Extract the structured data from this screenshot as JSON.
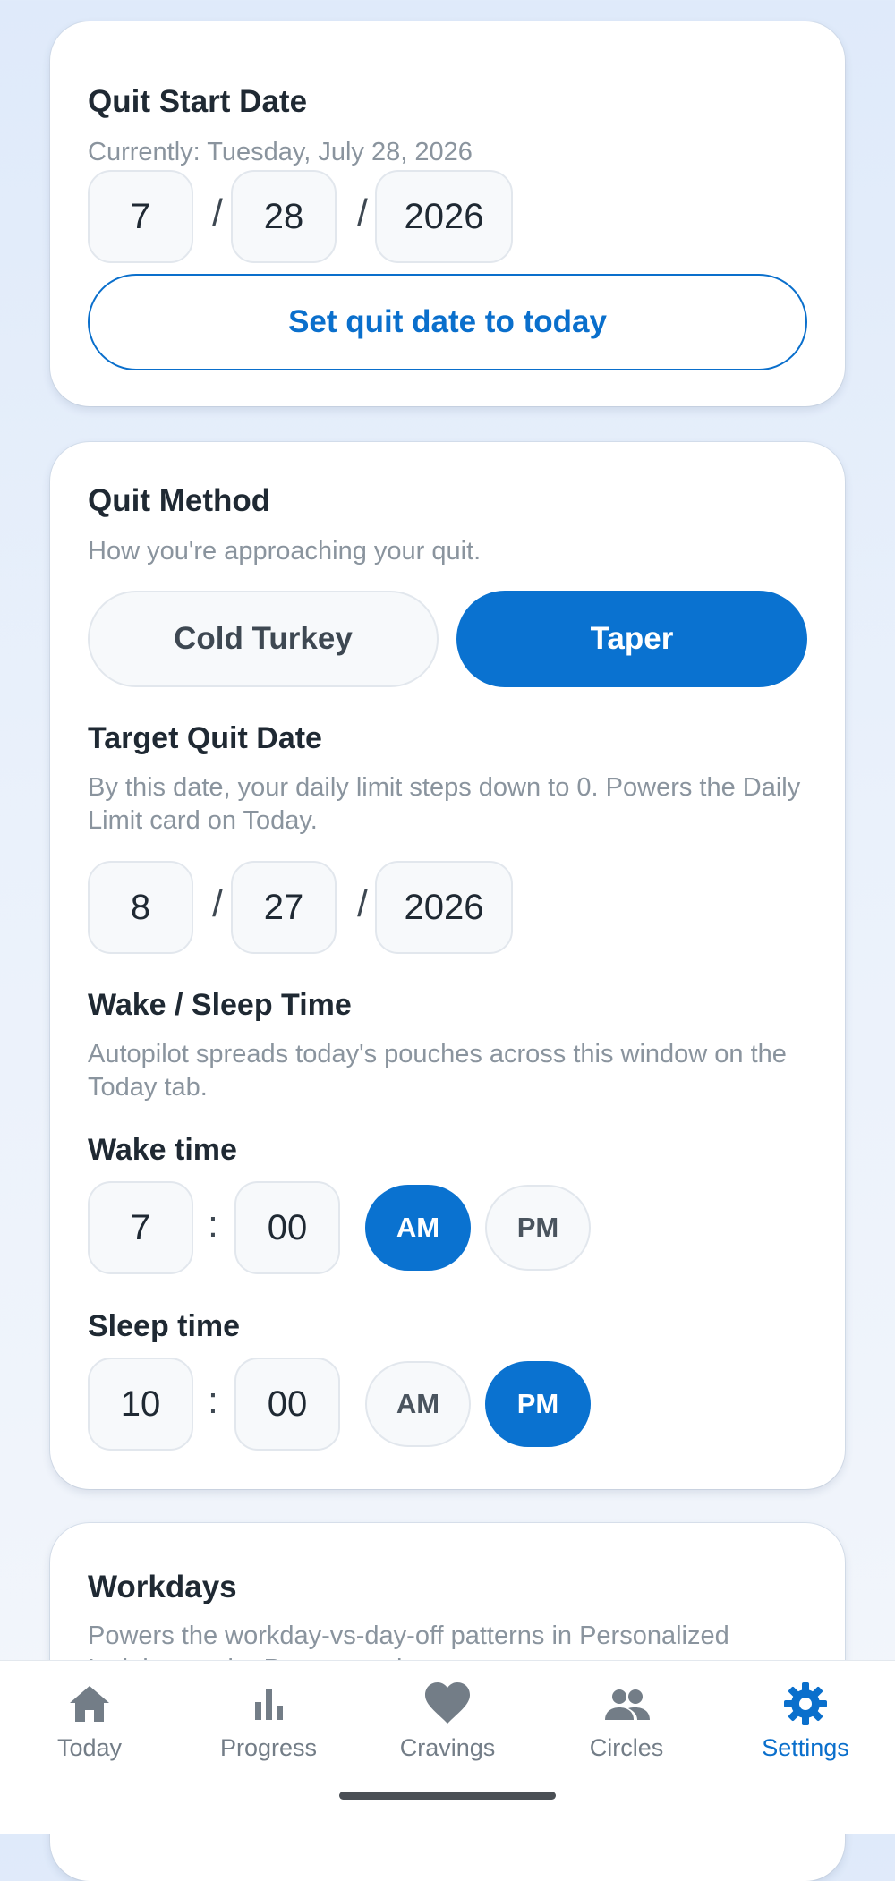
{
  "quit_start": {
    "title": "Quit Start Date",
    "currently": "Currently: Tuesday, July 28, 2026",
    "month": "7",
    "day": "28",
    "year": "2026",
    "sep": "/",
    "today_button": "Set quit date to today"
  },
  "quit_method": {
    "title": "Quit Method",
    "subtitle": "How you're approaching your quit.",
    "options": [
      "Cold Turkey",
      "Taper"
    ],
    "selected": "Taper",
    "target": {
      "title": "Target Quit Date",
      "subtitle": "By this date, your daily limit steps down to 0. Powers the Daily Limit card on Today.",
      "month": "8",
      "day": "27",
      "year": "2026"
    },
    "wake_sleep": {
      "title": "Wake / Sleep Time",
      "subtitle": "Autopilot spreads today's pouches across this window on the Today tab.",
      "colon": ":",
      "wake": {
        "label": "Wake time",
        "hour": "7",
        "minute": "00",
        "am": "AM",
        "pm": "PM",
        "selected": "AM"
      },
      "sleep": {
        "label": "Sleep time",
        "hour": "10",
        "minute": "00",
        "am": "AM",
        "pm": "PM",
        "selected": "PM"
      }
    }
  },
  "workdays": {
    "title": "Workdays",
    "subtitle": "Powers the workday-vs-day-off patterns in Personalized Insights on the Progress tab."
  },
  "tabs": [
    {
      "label": "Today",
      "icon": "home-icon"
    },
    {
      "label": "Progress",
      "icon": "bar-chart-icon"
    },
    {
      "label": "Cravings",
      "icon": "heart-icon"
    },
    {
      "label": "Circles",
      "icon": "people-icon"
    },
    {
      "label": "Settings",
      "icon": "gear-icon",
      "active": true
    }
  ],
  "colors": {
    "accent": "#0a72d0",
    "inactive": "#737d87"
  }
}
